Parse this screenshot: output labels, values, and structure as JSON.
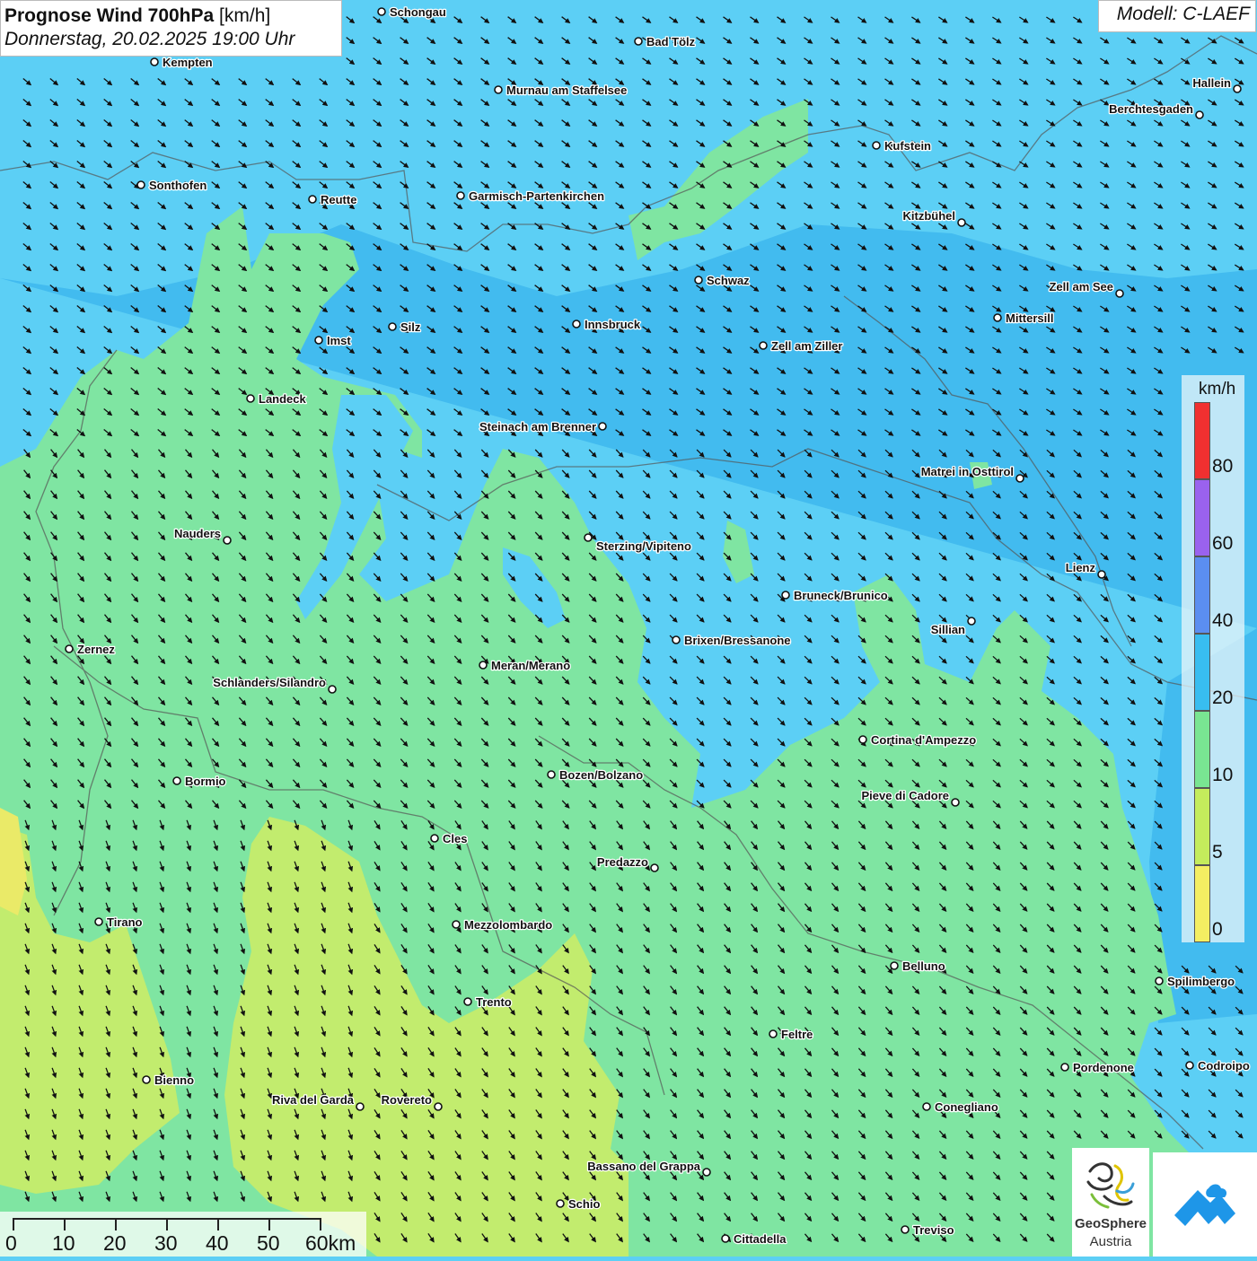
{
  "title": {
    "main": "Prognose Wind 700hPa",
    "unit": "[km/h]",
    "datetime": "Donnerstag, 20.02.2025 19:00 Uhr"
  },
  "model": "Modell: C-LAEF",
  "legend": {
    "unit": "km/h",
    "ticks": [
      "80",
      "60",
      "40",
      "20",
      "10",
      "5",
      "0"
    ],
    "bands": [
      {
        "from": 80,
        "color": "#f03030"
      },
      {
        "from": 60,
        "color": "#9a62ee"
      },
      {
        "from": 40,
        "color": "#5b8ef0"
      },
      {
        "from": 20,
        "color": "#38bdf0"
      },
      {
        "from": 10,
        "color": "#79e592"
      },
      {
        "from": 5,
        "color": "#c4ec5c"
      },
      {
        "from": 0,
        "color": "#f4ee62"
      }
    ]
  },
  "wind_direction": "north-west to south-east",
  "cities": [
    {
      "name": "Schongau"
    },
    {
      "name": "Bad Tölz"
    },
    {
      "name": "Kempten"
    },
    {
      "name": "Murnau am Staffelsee"
    },
    {
      "name": "Hallein"
    },
    {
      "name": "Berchtesgaden"
    },
    {
      "name": "Kufstein"
    },
    {
      "name": "Sonthofen"
    },
    {
      "name": "Reutte"
    },
    {
      "name": "Garmisch-Partenkirchen"
    },
    {
      "name": "Kitzbühel"
    },
    {
      "name": "Schwaz"
    },
    {
      "name": "Zell am See"
    },
    {
      "name": "Mittersill"
    },
    {
      "name": "Innsbruck"
    },
    {
      "name": "Silz"
    },
    {
      "name": "Imst"
    },
    {
      "name": "Zell am Ziller"
    },
    {
      "name": "Landeck"
    },
    {
      "name": "Steinach am Brenner"
    },
    {
      "name": "Matrei in Osttirol"
    },
    {
      "name": "Nauders"
    },
    {
      "name": "Sterzing/Vipiteno"
    },
    {
      "name": "Lienz"
    },
    {
      "name": "Bruneck/Brunico"
    },
    {
      "name": "Sillian"
    },
    {
      "name": "Brixen/Bressanone"
    },
    {
      "name": "Zernez"
    },
    {
      "name": "Meran/Merano"
    },
    {
      "name": "Schlanders/Silandro"
    },
    {
      "name": "Cortina d'Ampezzo"
    },
    {
      "name": "Bozen/Bolzano"
    },
    {
      "name": "Bormio"
    },
    {
      "name": "Pieve di Cadore"
    },
    {
      "name": "Cles"
    },
    {
      "name": "Predazzo"
    },
    {
      "name": "Tirano"
    },
    {
      "name": "Mezzolombardo"
    },
    {
      "name": "Belluno"
    },
    {
      "name": "Spilimbergo"
    },
    {
      "name": "Trento"
    },
    {
      "name": "Feltre"
    },
    {
      "name": "Bienno"
    },
    {
      "name": "Pordenone"
    },
    {
      "name": "Codroipo"
    },
    {
      "name": "Riva del Garda"
    },
    {
      "name": "Rovereto"
    },
    {
      "name": "Conegliano"
    },
    {
      "name": "Bassano del Grappa"
    },
    {
      "name": "Schio"
    },
    {
      "name": "Treviso"
    },
    {
      "name": "Cittadella"
    }
  ],
  "scale": {
    "ticks": [
      "0",
      "10",
      "20",
      "30",
      "40",
      "50",
      "60km"
    ]
  },
  "logos": {
    "geosphere_name": "GeoSphere",
    "geosphere_sub": "Austria"
  }
}
